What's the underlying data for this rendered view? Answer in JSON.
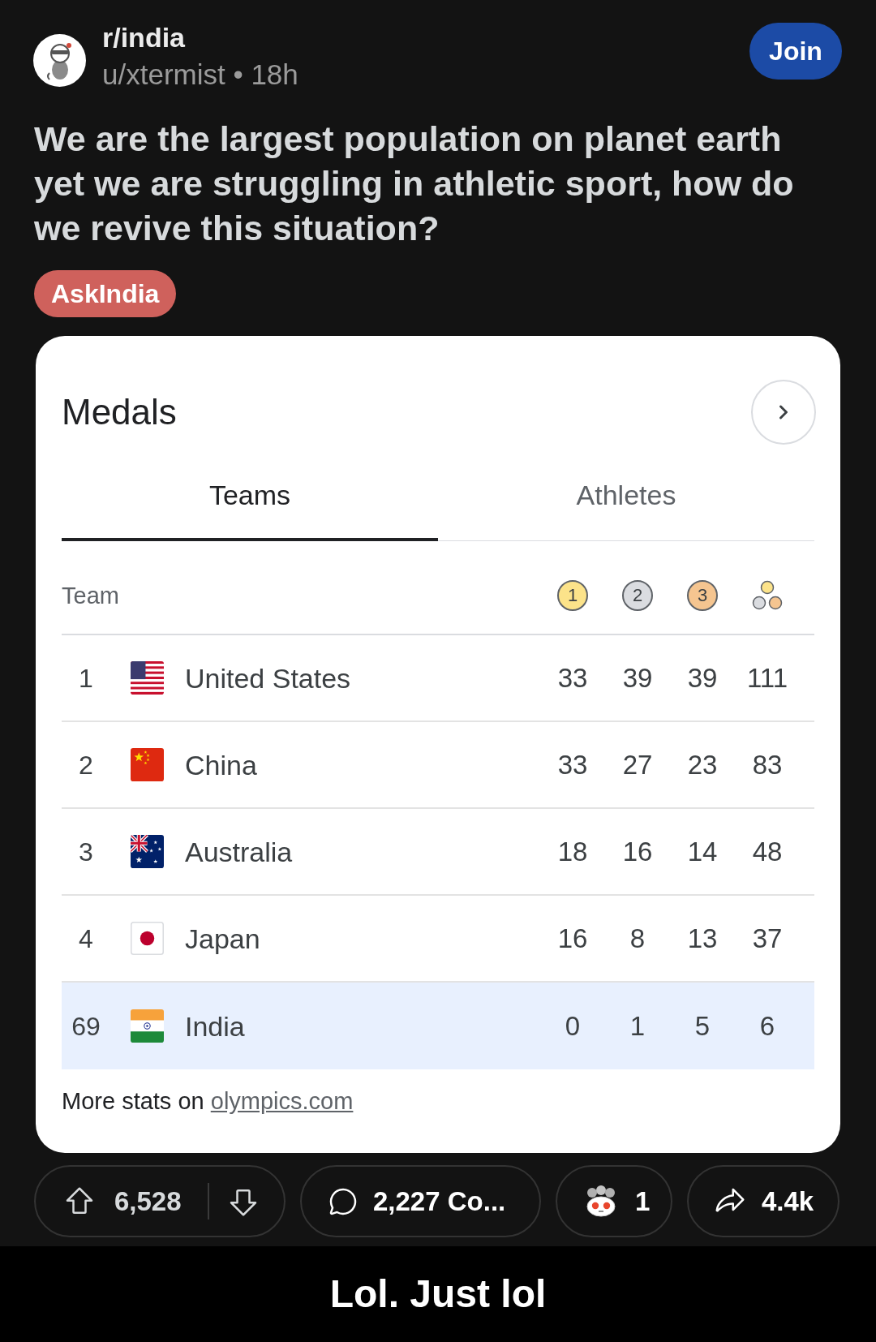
{
  "post": {
    "subreddit": "r/india",
    "meta": "u/xtermist • 18h",
    "join_label": "Join",
    "title": "We are the largest population on planet earth yet we are struggling in athletic sport, how do we revive this situation?",
    "flair": "AskIndia"
  },
  "medals_card": {
    "title": "Medals",
    "tabs": [
      {
        "label": "Teams",
        "selected": true
      },
      {
        "label": "Athletes",
        "selected": false
      }
    ],
    "table": {
      "columns": [
        {
          "kind": "team",
          "label": "Team"
        },
        {
          "kind": "medal",
          "label": "1",
          "color": "#fce38a"
        },
        {
          "kind": "medal",
          "label": "2",
          "color": "#dadce0"
        },
        {
          "kind": "medal",
          "label": "3",
          "color": "#f5c590"
        },
        {
          "kind": "total"
        }
      ],
      "rows": [
        {
          "rank": "1",
          "flag": {
            "kind": "us"
          },
          "team": "United States",
          "counts": [
            "33",
            "39",
            "39",
            "111"
          ],
          "highlighted": false
        },
        {
          "rank": "2",
          "flag": {
            "kind": "cn"
          },
          "team": "China",
          "counts": [
            "33",
            "27",
            "23",
            "83"
          ],
          "highlighted": false
        },
        {
          "rank": "3",
          "flag": {
            "kind": "au"
          },
          "team": "Australia",
          "counts": [
            "18",
            "16",
            "14",
            "48"
          ],
          "highlighted": false
        },
        {
          "rank": "4",
          "flag": {
            "kind": "jp"
          },
          "team": "Japan",
          "counts": [
            "16",
            "8",
            "13",
            "37"
          ],
          "highlighted": false
        },
        {
          "rank": "69",
          "flag": {
            "kind": "in"
          },
          "team": "India",
          "counts": [
            "0",
            "1",
            "5",
            "6"
          ],
          "highlighted": true
        }
      ]
    },
    "footer": {
      "text": "More stats on",
      "link": "olympics.com"
    }
  },
  "actions": {
    "upvotes": "6,528",
    "comments": "2,227 Co...",
    "awards": "1",
    "shares": "4.4k"
  },
  "caption": "Lol. Just lol"
}
